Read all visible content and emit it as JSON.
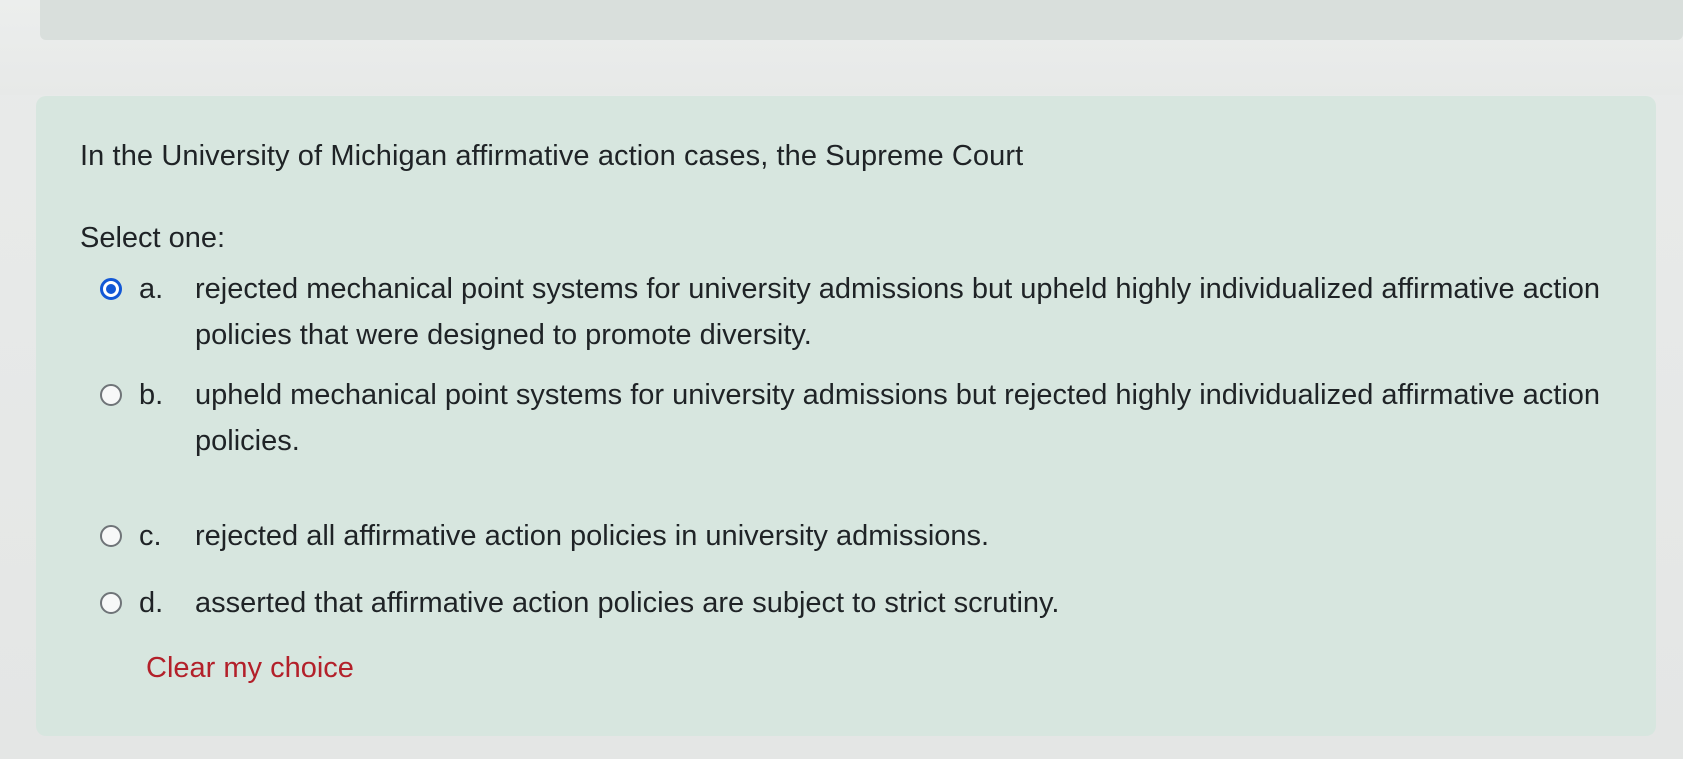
{
  "question": {
    "text": "In the University of Michigan affirmative action cases, the Supreme Court",
    "prompt": "Select one:"
  },
  "answers": [
    {
      "letter": "a.",
      "text": "rejected mechanical point systems for university admissions but upheld highly individualized affirmative action policies that were designed to promote diversity.",
      "selected": true
    },
    {
      "letter": "b.",
      "text": "upheld mechanical point systems for university admissions but rejected highly individualized affirmative action policies.",
      "selected": false
    },
    {
      "letter": "c.",
      "text": "rejected all affirmative action policies in university admissions.",
      "selected": false
    },
    {
      "letter": "d.",
      "text": "asserted that affirmative action policies are subject to strict scrutiny.",
      "selected": false
    }
  ],
  "actions": {
    "clear_label": "Clear my choice"
  },
  "colors": {
    "card_background": "#d7e6df",
    "radio_selected": "#1257d6",
    "link": "#b3202a",
    "text": "#1f2326"
  }
}
